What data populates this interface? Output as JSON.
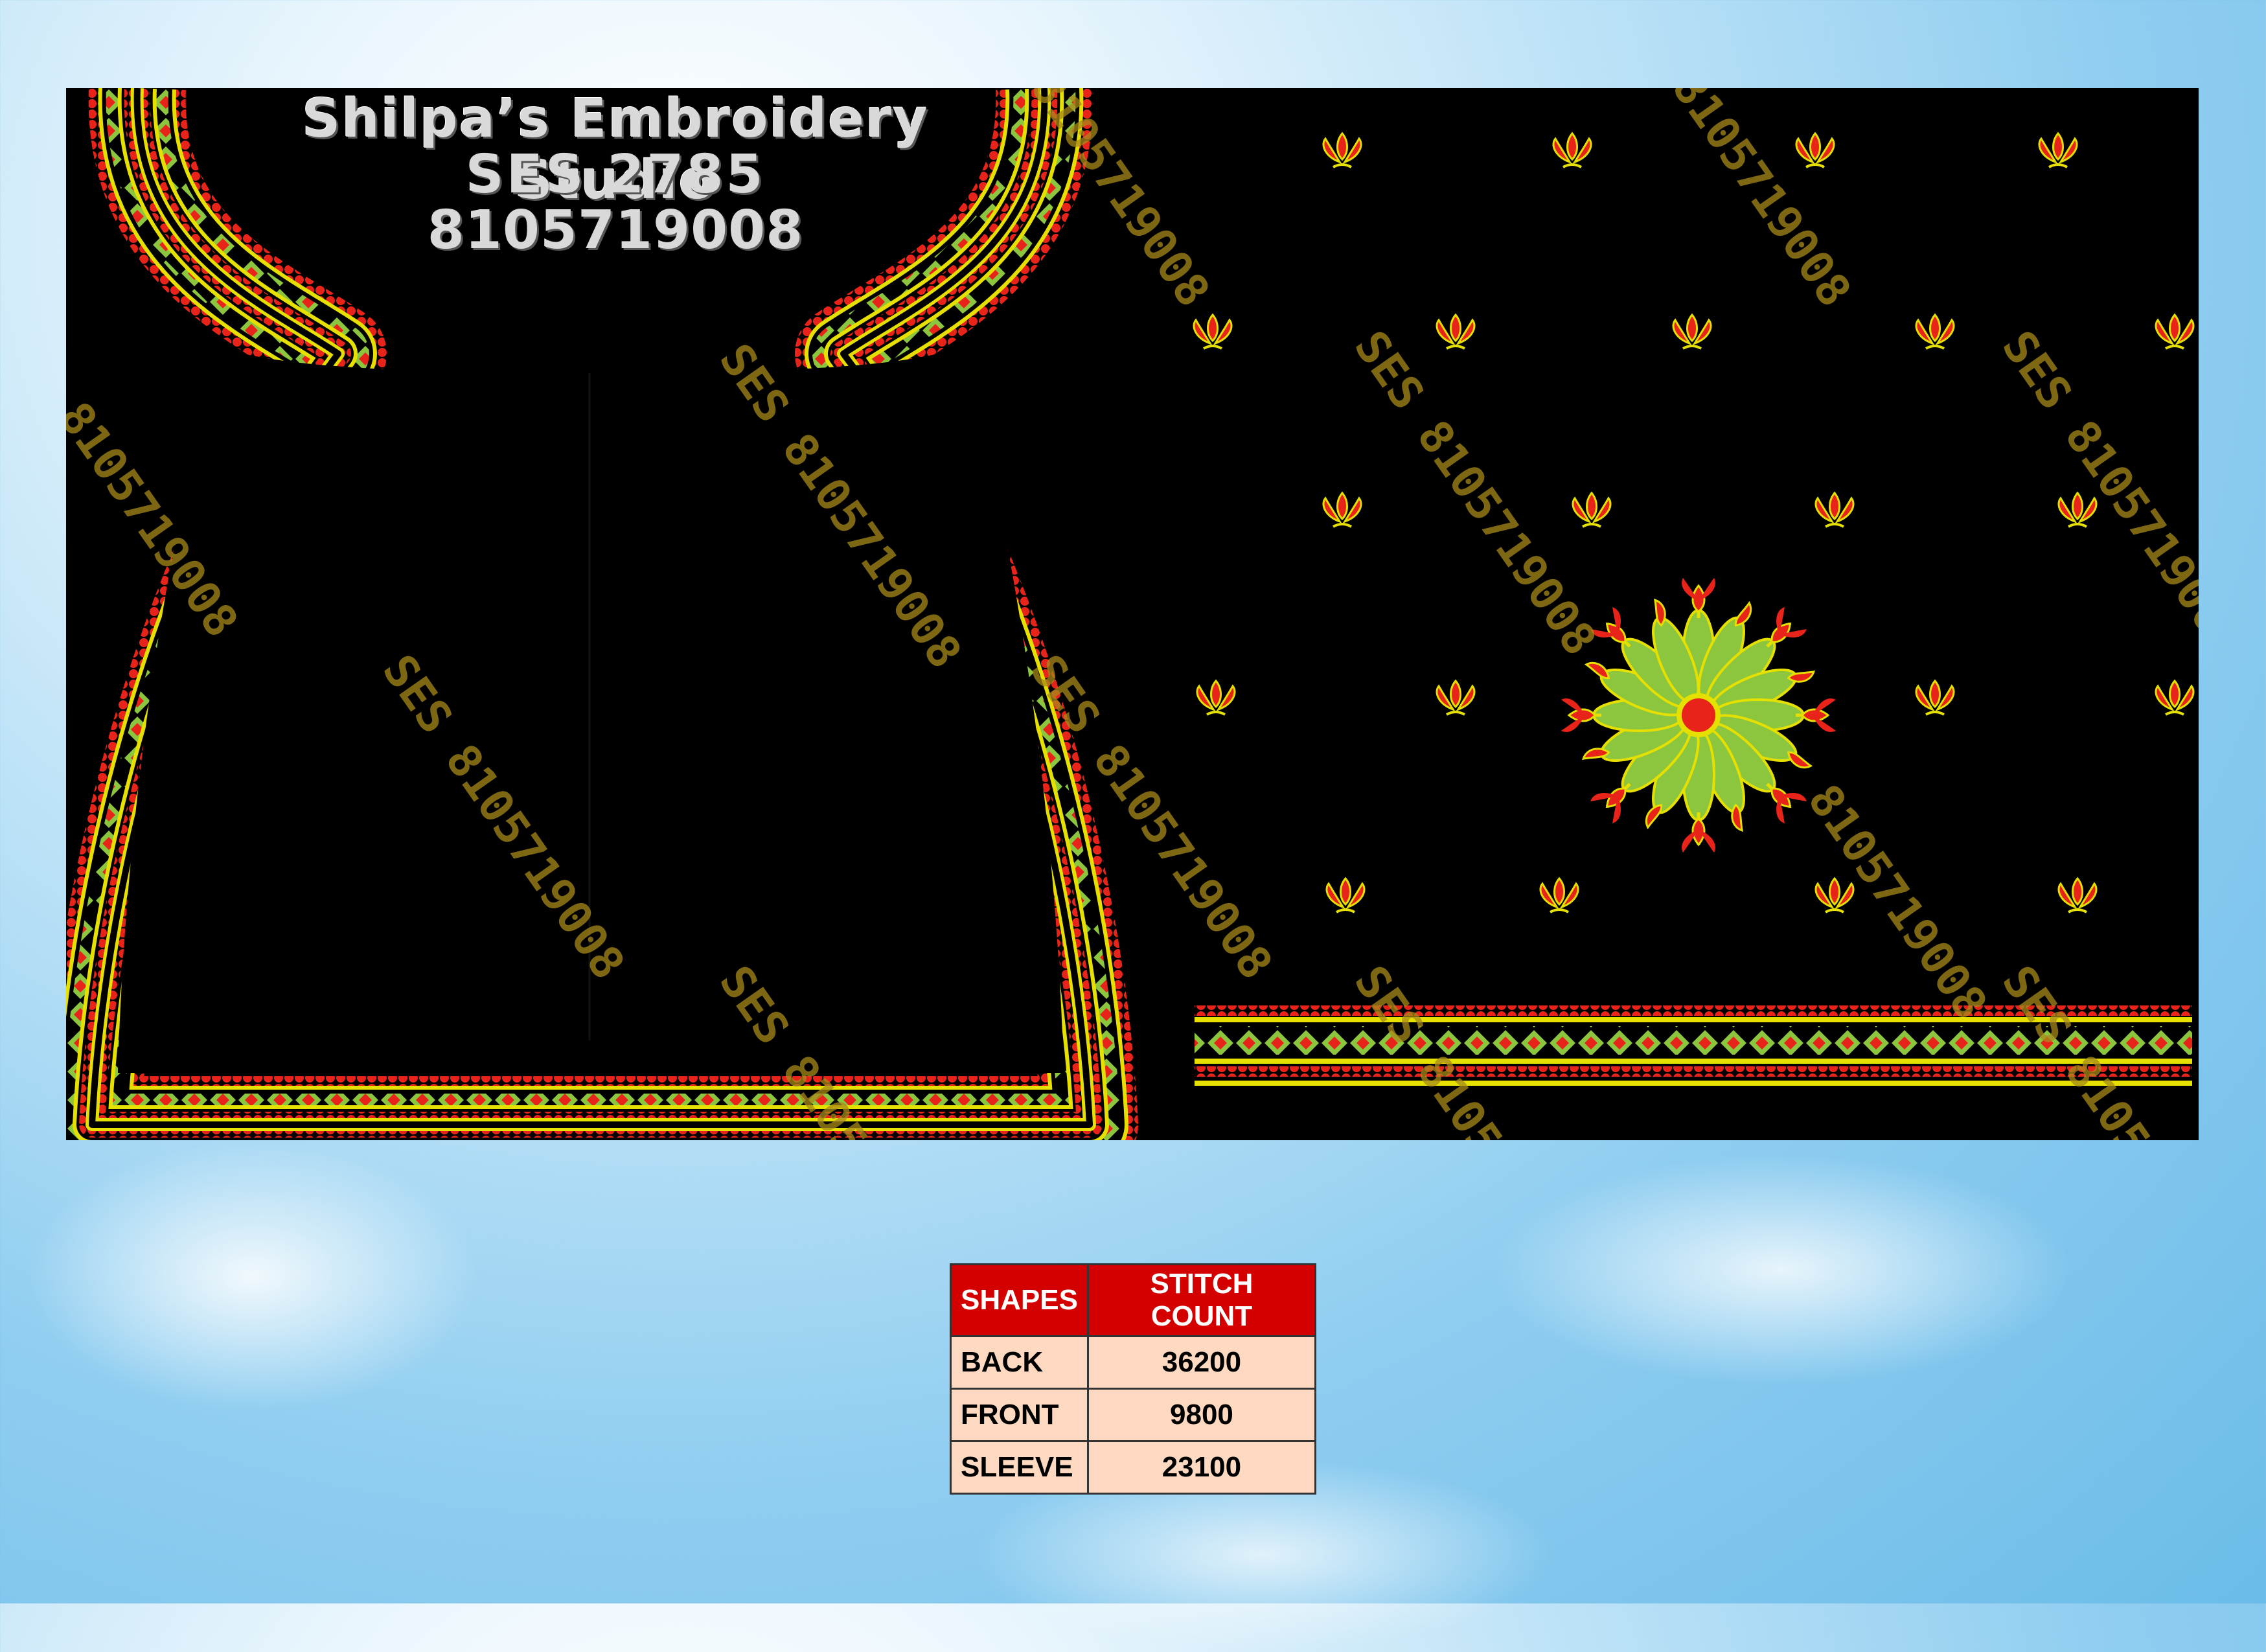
{
  "header": {
    "studio_name": "Shilpa’s Embroidery Studio",
    "design_code": "SES 2785",
    "phone": "8105719008"
  },
  "watermark": {
    "text": "SES 8105719008",
    "partial_text": "8105719008"
  },
  "colors": {
    "canvas_bg": "#000000",
    "thread_red": "#e8241a",
    "thread_yellow": "#e6e000",
    "thread_green": "#8cc63f",
    "table_header_bg": "#d40000",
    "table_cell_bg": "#fcd9c0"
  },
  "stitch_table": {
    "headers": [
      "SHAPES",
      "STITCH COUNT"
    ],
    "rows": [
      {
        "shape": "BACK",
        "count": "36200"
      },
      {
        "shape": "FRONT",
        "count": "9800"
      },
      {
        "shape": "SLEEVE",
        "count": "23100"
      }
    ]
  }
}
